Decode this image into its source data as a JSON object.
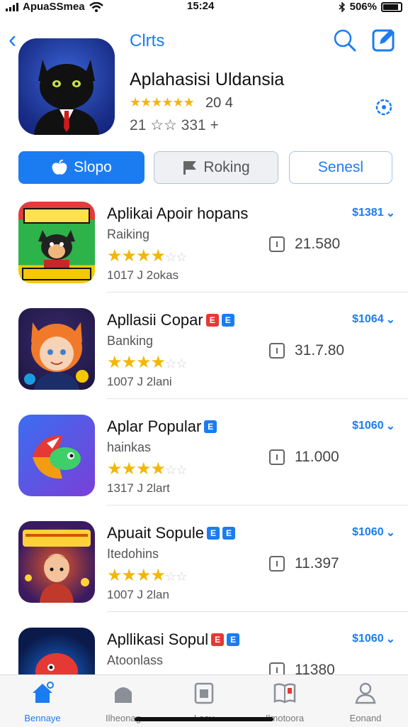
{
  "status": {
    "carrier": "ApuaSSmea",
    "time": "15:24",
    "battery": "506%"
  },
  "nav": {
    "title": "Clrts"
  },
  "header_app": {
    "name": "Aplahasisi Uldansia",
    "rating": "20 4",
    "meta": "21 ☆☆  331 +"
  },
  "segments": [
    "Slopo",
    "Roking",
    "Senesl"
  ],
  "apps": [
    {
      "name": "Aplikai Apoir hopans",
      "badges": [],
      "subtitle": "Raiking",
      "date": "1017 J 2okas",
      "count": "21.580",
      "price": "$1381"
    },
    {
      "name": "Apllasii Copar",
      "badges": [
        "red",
        "blue"
      ],
      "subtitle": "Banking",
      "date": "1007 J 2lani",
      "count": "31.7.80",
      "price": "$1064"
    },
    {
      "name": "Aplar Popular",
      "badges": [
        "blue"
      ],
      "subtitle": "hainkas",
      "date": "1317 J 2lart",
      "count": "11.000",
      "price": "$1060"
    },
    {
      "name": "Apuait Sopule",
      "badges": [
        "blue",
        "blue"
      ],
      "subtitle": "Itedohins",
      "date": "1007 J 2lan",
      "count": "11.397",
      "price": "$1060"
    },
    {
      "name": "Apllikasi Sopul",
      "badges": [
        "red",
        "blue"
      ],
      "subtitle": "Atoonlass",
      "date": "",
      "count": "11380",
      "price": "$1060"
    }
  ],
  "tabs": [
    {
      "label": "Bennaye",
      "icon": "home-icon",
      "active": true
    },
    {
      "label": "Ilheonag",
      "icon": "house-icon",
      "active": false
    },
    {
      "label": "Laev",
      "icon": "box-icon",
      "active": false
    },
    {
      "label": "Ilmotoora",
      "icon": "book-icon",
      "active": false
    },
    {
      "label": "Eonand",
      "icon": "person-icon",
      "active": false
    }
  ],
  "colors": {
    "accent": "#1b7cf2",
    "star": "#f2b705"
  }
}
